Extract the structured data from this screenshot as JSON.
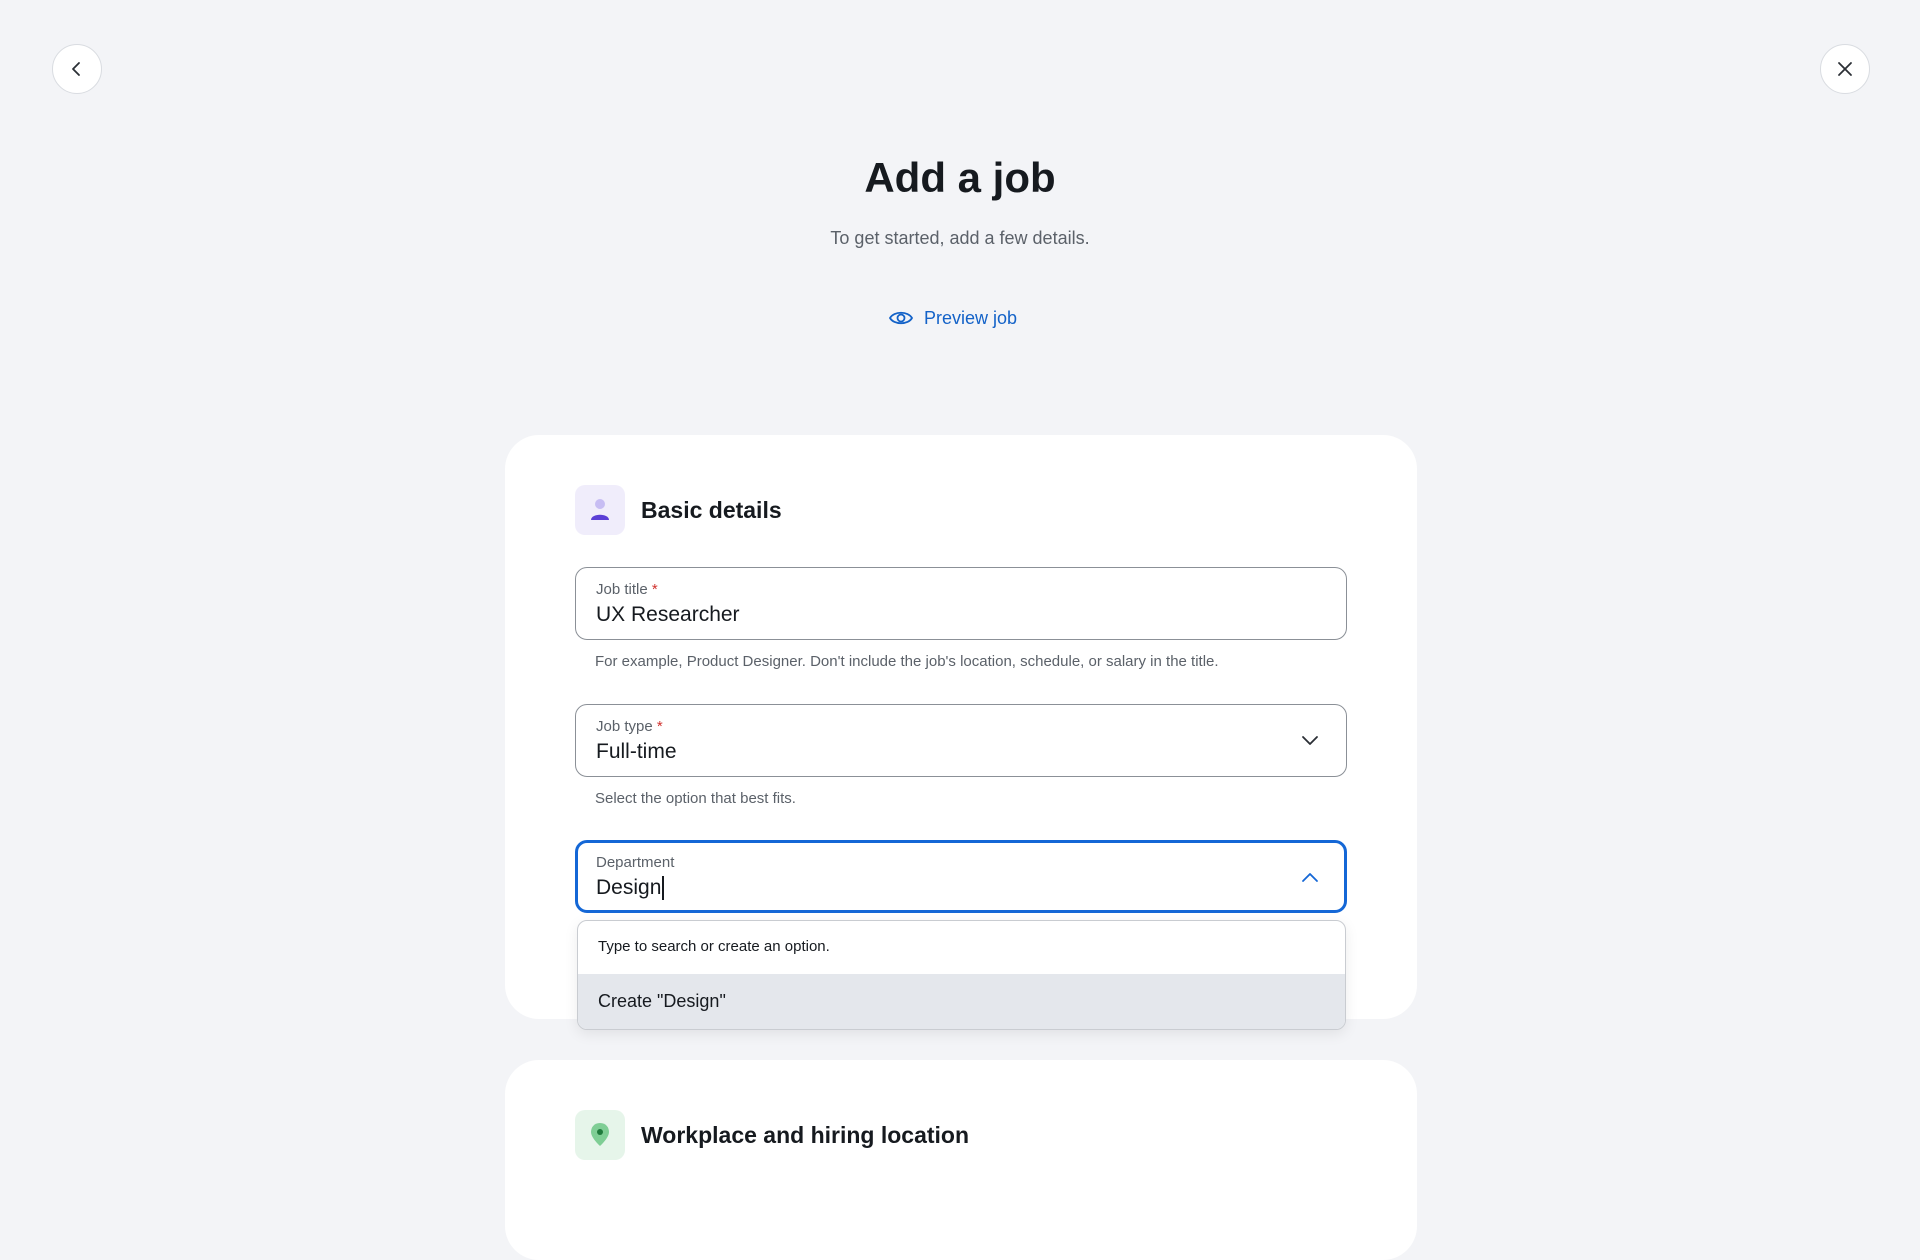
{
  "nav": {
    "back_icon": "chevron-left-icon",
    "close_icon": "close-icon"
  },
  "header": {
    "title": "Add a job",
    "subtitle": "To get started, add a few details.",
    "preview_label": "Preview job",
    "preview_icon": "eye-icon"
  },
  "basic_details": {
    "title": "Basic details",
    "icon": "person-icon",
    "job_title": {
      "label": "Job title",
      "required_mark": "*",
      "value": "UX Researcher",
      "help": "For example, Product Designer. Don't include the job's location, schedule, or salary in the title."
    },
    "job_type": {
      "label": "Job type",
      "required_mark": "*",
      "value": "Full-time",
      "help": "Select the option that best fits."
    },
    "department": {
      "label": "Department",
      "value": "Design",
      "dropdown_hint": "Type to search or create an option.",
      "create_option": "Create \"Design\""
    }
  },
  "workplace": {
    "title": "Workplace and hiring location",
    "icon": "location-pin-icon"
  },
  "colors": {
    "background": "#f3f4f7",
    "accent": "#1467d6",
    "link": "#1362c8",
    "required": "#d0312d",
    "basic_icon_bg": "#f0edfb",
    "basic_icon": "#5b3fd6",
    "workplace_icon_bg": "#e6f5ea",
    "workplace_icon": "#2f9a51"
  }
}
